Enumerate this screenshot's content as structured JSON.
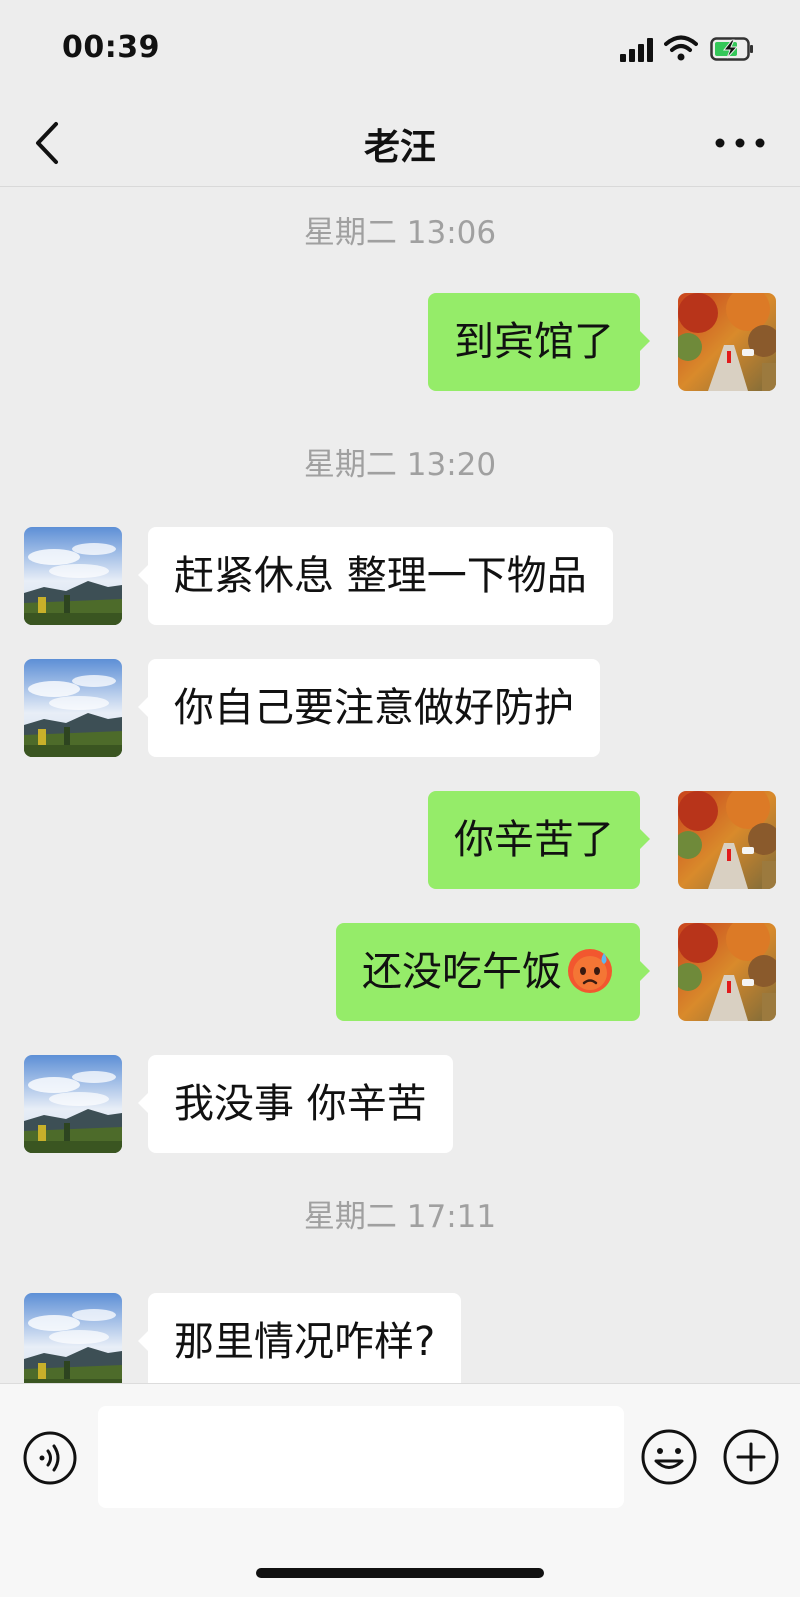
{
  "status_bar": {
    "time": "00:39",
    "icons": [
      "signal-icon",
      "wifi-icon",
      "battery-charging-icon"
    ]
  },
  "header": {
    "title": "老汪",
    "back_icon": "chevron-left-icon",
    "more_icon": "more-dots-icon"
  },
  "messages": [
    {
      "type": "timestamp",
      "text": "星期二 13:06"
    },
    {
      "type": "outgoing",
      "text": "到宾馆了"
    },
    {
      "type": "timestamp",
      "text": "星期二 13:20"
    },
    {
      "type": "incoming",
      "text": "赶紧休息 整理一下物品"
    },
    {
      "type": "incoming",
      "text": "你自己要注意做好防护"
    },
    {
      "type": "outgoing",
      "text": "你辛苦了"
    },
    {
      "type": "outgoing",
      "text": "还没吃午饭",
      "emoji": "anxious-sweat-face-emoji"
    },
    {
      "type": "incoming",
      "text": "我没事 你辛苦"
    },
    {
      "type": "timestamp",
      "text": "星期二 17:11"
    },
    {
      "type": "incoming",
      "text": "那里情况咋样?"
    }
  ],
  "input_bar": {
    "text": "",
    "icons": [
      "voice-icon",
      "emoji-face-icon",
      "plus-icon"
    ]
  },
  "colors": {
    "background": "#ededed",
    "outgoing_bubble": "#95ec69",
    "incoming_bubble": "#ffffff",
    "timestamp": "#a0a0a0"
  }
}
